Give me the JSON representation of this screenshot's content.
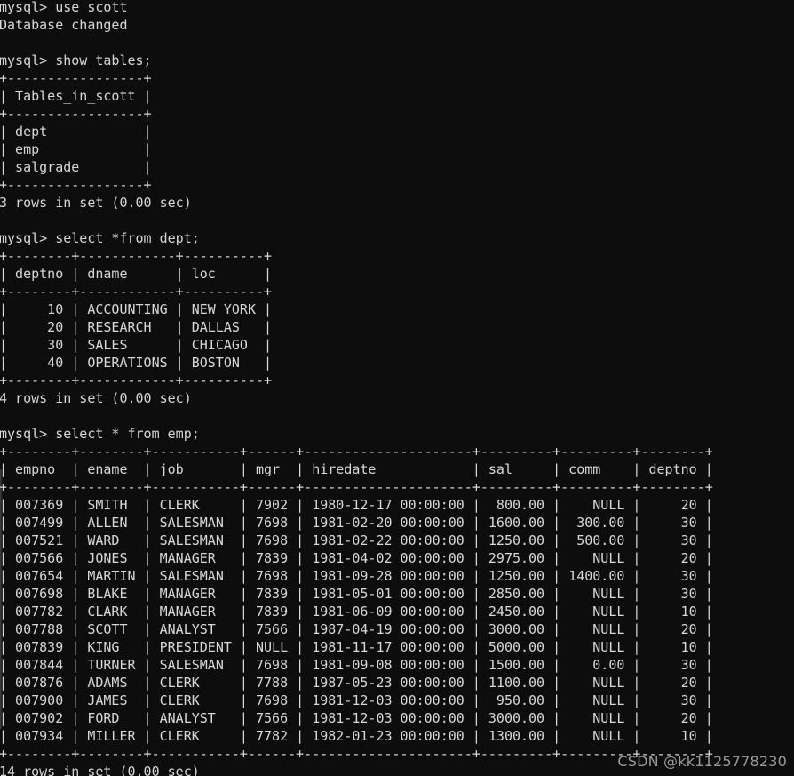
{
  "terminal": {
    "background_color": "#0d0d0d",
    "text_color": "#d8d8d8",
    "prompt": "mysql> ",
    "watermark": "CSDN @kk1125778230",
    "watermark_color": "#9a9a9a"
  },
  "blocks": [
    {
      "name": "use-scott",
      "command": "mysql> use scott",
      "response": "Database changed"
    },
    {
      "name": "show-tables",
      "command": "mysql> show tables;",
      "columns": [
        "Tables_in_scott"
      ],
      "widths": [
        17
      ],
      "aligns": [
        "left"
      ],
      "rows": [
        [
          "dept"
        ],
        [
          "emp"
        ],
        [
          "salgrade"
        ]
      ],
      "status": "3 rows in set (0.00 sec)"
    },
    {
      "name": "select-dept",
      "command": "mysql> select *from dept;",
      "columns": [
        "deptno",
        "dname",
        "loc"
      ],
      "widths": [
        8,
        12,
        10
      ],
      "aligns": [
        "right",
        "left",
        "left"
      ],
      "rows": [
        [
          "10",
          "ACCOUNTING",
          "NEW YORK"
        ],
        [
          "20",
          "RESEARCH",
          "DALLAS"
        ],
        [
          "30",
          "SALES",
          "CHICAGO"
        ],
        [
          "40",
          "OPERATIONS",
          "BOSTON"
        ]
      ],
      "status": "4 rows in set (0.00 sec)"
    },
    {
      "name": "select-emp",
      "command": "mysql> select * from emp;",
      "columns": [
        "empno",
        "ename",
        "job",
        "mgr",
        "hiredate",
        "sal",
        "comm",
        "deptno"
      ],
      "widths": [
        8,
        8,
        11,
        6,
        21,
        9,
        9,
        8
      ],
      "aligns": [
        "right",
        "left",
        "left",
        "right",
        "left",
        "right",
        "right",
        "right"
      ],
      "rows": [
        [
          "007369",
          "SMITH",
          "CLERK",
          "7902",
          "1980-12-17 00:00:00",
          "800.00",
          "NULL",
          "20"
        ],
        [
          "007499",
          "ALLEN",
          "SALESMAN",
          "7698",
          "1981-02-20 00:00:00",
          "1600.00",
          "300.00",
          "30"
        ],
        [
          "007521",
          "WARD",
          "SALESMAN",
          "7698",
          "1981-02-22 00:00:00",
          "1250.00",
          "500.00",
          "30"
        ],
        [
          "007566",
          "JONES",
          "MANAGER",
          "7839",
          "1981-04-02 00:00:00",
          "2975.00",
          "NULL",
          "20"
        ],
        [
          "007654",
          "MARTIN",
          "SALESMAN",
          "7698",
          "1981-09-28 00:00:00",
          "1250.00",
          "1400.00",
          "30"
        ],
        [
          "007698",
          "BLAKE",
          "MANAGER",
          "7839",
          "1981-05-01 00:00:00",
          "2850.00",
          "NULL",
          "30"
        ],
        [
          "007782",
          "CLARK",
          "MANAGER",
          "7839",
          "1981-06-09 00:00:00",
          "2450.00",
          "NULL",
          "10"
        ],
        [
          "007788",
          "SCOTT",
          "ANALYST",
          "7566",
          "1987-04-19 00:00:00",
          "3000.00",
          "NULL",
          "20"
        ],
        [
          "007839",
          "KING",
          "PRESIDENT",
          "NULL",
          "1981-11-17 00:00:00",
          "5000.00",
          "NULL",
          "10"
        ],
        [
          "007844",
          "TURNER",
          "SALESMAN",
          "7698",
          "1981-09-08 00:00:00",
          "1500.00",
          "0.00",
          "30"
        ],
        [
          "007876",
          "ADAMS",
          "CLERK",
          "7788",
          "1987-05-23 00:00:00",
          "1100.00",
          "NULL",
          "20"
        ],
        [
          "007900",
          "JAMES",
          "CLERK",
          "7698",
          "1981-12-03 00:00:00",
          "950.00",
          "NULL",
          "30"
        ],
        [
          "007902",
          "FORD",
          "ANALYST",
          "7566",
          "1981-12-03 00:00:00",
          "3000.00",
          "NULL",
          "20"
        ],
        [
          "007934",
          "MILLER",
          "CLERK",
          "7782",
          "1982-01-23 00:00:00",
          "1300.00",
          "NULL",
          "10"
        ]
      ],
      "status": "14 rows in set (0.00 sec)"
    }
  ]
}
